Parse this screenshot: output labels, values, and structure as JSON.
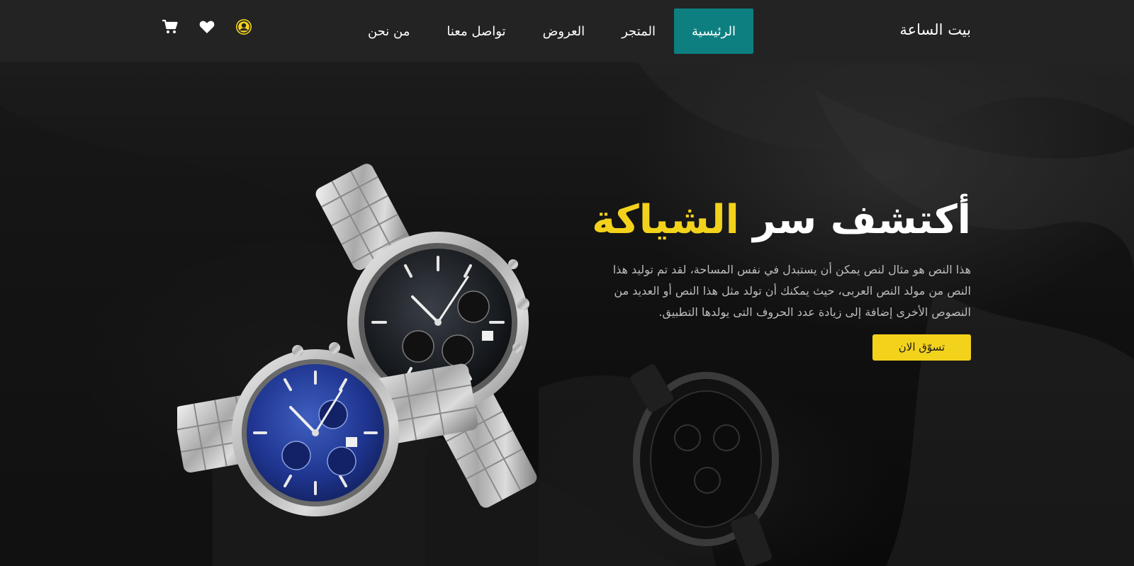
{
  "nav": {
    "brand": "بيت الساعة",
    "links": [
      {
        "label": "الرئيسية",
        "active": true
      },
      {
        "label": "المتجر",
        "active": false
      },
      {
        "label": "العروض",
        "active": false
      },
      {
        "label": "تواصل معنا",
        "active": false
      },
      {
        "label": "من نحن",
        "active": false
      }
    ],
    "icons": [
      "user-circle-icon",
      "heart-icon",
      "cart-icon"
    ]
  },
  "hero": {
    "title_main": "أكتشف سر",
    "title_accent": "الشياكة",
    "description": "هذا النص هو مثال لنص يمكن أن يستبدل في نفس المساحة، لقد تم توليد هذا النص من مولد النص العربى، حيث يمكنك أن تولد مثل هذا النص أو العديد من النصوص الأخرى إضافة إلى زيادة عدد الحروف التى يولدها التطبيق.",
    "cta_label": "تسوّق الان"
  },
  "colors": {
    "accent_yellow": "#f3d21c",
    "active_teal": "#0e7f80",
    "navbar_bg": "#232323"
  }
}
